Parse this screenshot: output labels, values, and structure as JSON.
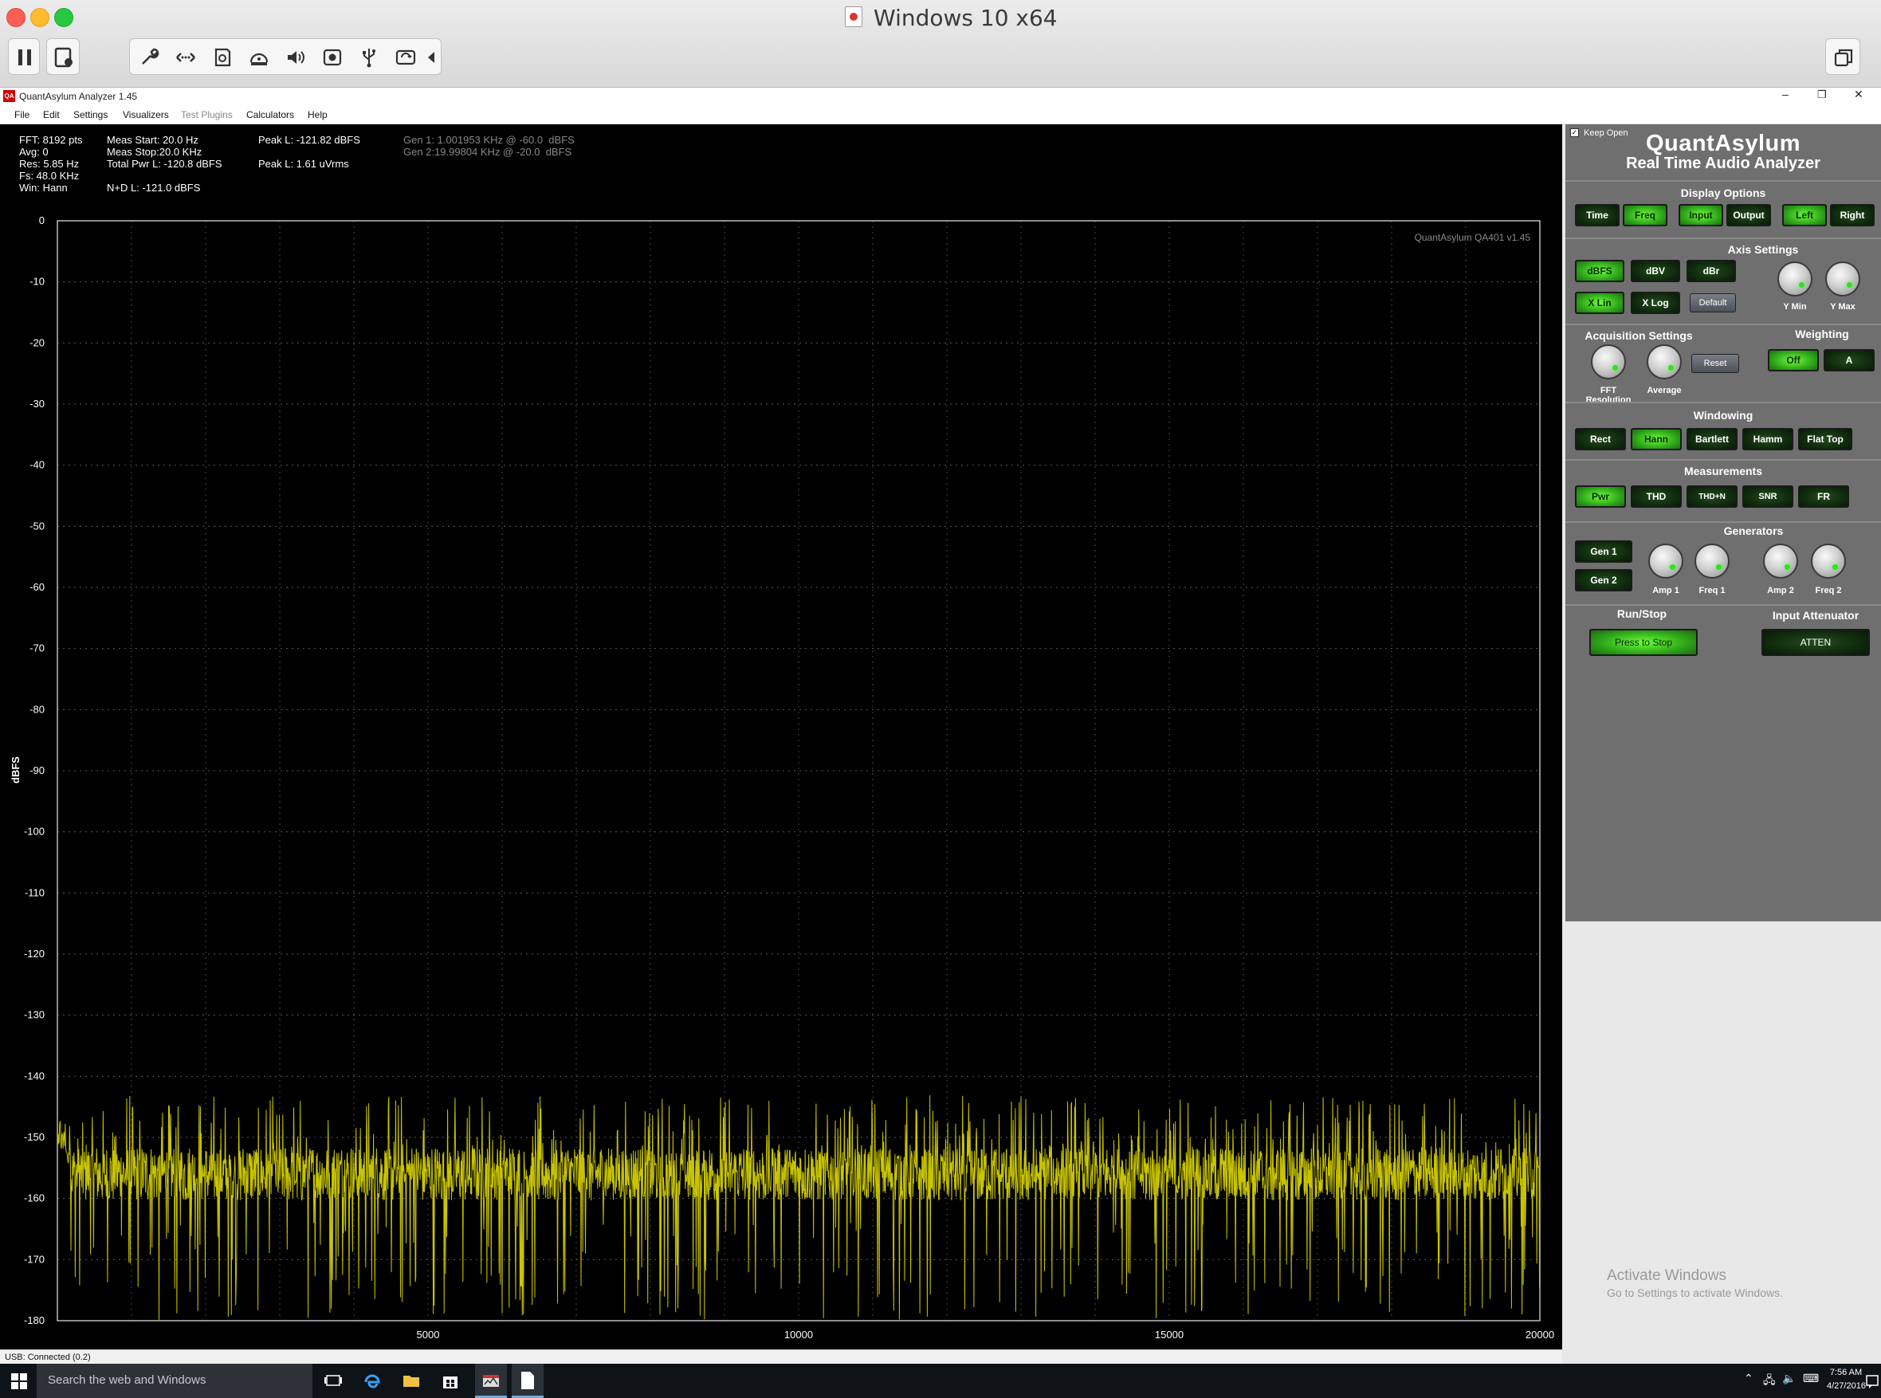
{
  "window": {
    "title": "Windows 10 x64"
  },
  "app": {
    "title": "QuantAsylum Analyzer 1.45",
    "logo_text": "QA"
  },
  "menu": [
    "File",
    "Edit",
    "Settings",
    "Visualizers",
    "Test Plugins",
    "Calculators",
    "Help"
  ],
  "stats": {
    "col1": [
      "FFT: 8192 pts",
      "Avg: 0",
      "Res: 5.85 Hz",
      "Fs: 48.0 KHz",
      "Win: Hann"
    ],
    "col2": [
      "Meas Start: 20.0 Hz",
      "Meas Stop:20.0 KHz",
      "Total Pwr L: -120.8 dBFS",
      "",
      "N+D L: -121.0 dBFS"
    ],
    "col3": [
      "Peak L: -121.82 dBFS",
      "",
      "Peak L: 1.61 uVrms"
    ],
    "col4": [
      "Gen 1: 1.001953 KHz @ -60.0  dBFS",
      "Gen 2:19.99804 KHz @ -20.0  dBFS"
    ]
  },
  "chart_data": {
    "type": "line",
    "ylabel": "dBFS",
    "watermark": "QuantAsylum QA401 v1.45",
    "xlim": [
      0,
      20000
    ],
    "ylim": [
      -180,
      0
    ],
    "x_ticks": [
      5000,
      10000,
      15000,
      20000
    ],
    "y_ticks": [
      0,
      -10,
      -20,
      -30,
      -40,
      -50,
      -60,
      -70,
      -80,
      -90,
      -100,
      -110,
      -120,
      -130,
      -140,
      -150,
      -160,
      -170,
      -180
    ],
    "grid": true,
    "series": [
      {
        "color": "#c8c400",
        "noise_floor_mean": -156,
        "noise_floor_peak": -143,
        "noise_floor_min": -180
      }
    ]
  },
  "status": {
    "text": "USB: Connected  (0.2)"
  },
  "panel": {
    "keep_open": "Keep Open",
    "brand": "QuantAsylum",
    "subtitle": "Real Time Audio Analyzer",
    "display_options": {
      "header": "Display Options",
      "buttons": [
        "Time",
        "Freq",
        "Input",
        "Output",
        "Left",
        "Right"
      ]
    },
    "axis_settings": {
      "header": "Axis Settings",
      "units": [
        "dBFS",
        "dBV",
        "dBr"
      ],
      "scale": [
        "X Lin",
        "X Log"
      ],
      "default": "Default",
      "knobs": [
        "Y Min",
        "Y Max"
      ]
    },
    "acquisition": {
      "header": "Acquisition Settings",
      "knobs": [
        "FFT Resolution",
        "Average"
      ],
      "reset": "Reset"
    },
    "weighting": {
      "header": "Weighting",
      "buttons": [
        "Off",
        "A"
      ]
    },
    "windowing": {
      "header": "Windowing",
      "buttons": [
        "Rect",
        "Hann",
        "Bartlett",
        "Hamm",
        "Flat Top"
      ]
    },
    "measurements": {
      "header": "Measurements",
      "buttons": [
        "Pwr",
        "THD",
        "THD+N",
        "SNR",
        "FR"
      ]
    },
    "generators": {
      "header": "Generators",
      "buttons": [
        "Gen 1",
        "Gen 2"
      ],
      "knobs": [
        "Amp 1",
        "Freq 1",
        "Amp 2",
        "Freq 2"
      ]
    },
    "run_stop": {
      "header": "Run/Stop",
      "button": "Press to Stop"
    },
    "attenuator": {
      "header": "Input Attenuator",
      "button": "ATTEN"
    }
  },
  "activate": {
    "line1": "Activate Windows",
    "line2": "Go to Settings to activate Windows."
  },
  "taskbar": {
    "search_placeholder": "Search the web and Windows",
    "time": "7:56 AM",
    "date": "4/27/2016"
  },
  "colors": {
    "trace": "#c8c400",
    "grid": "#3c3c3c",
    "button_on": "#3fd41f",
    "panel_bg": "#6f6f6f"
  }
}
